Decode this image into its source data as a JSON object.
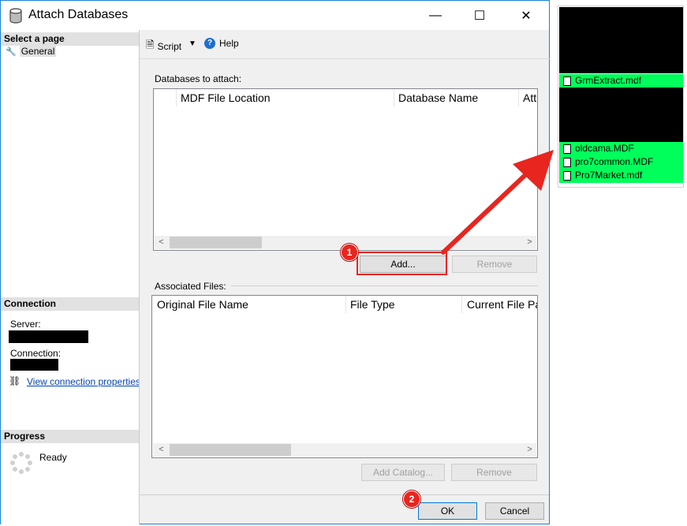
{
  "window": {
    "title": "Attach Databases",
    "minimize": "—",
    "maximize": "☐",
    "close": "✕"
  },
  "left_pane": {
    "select_page_header": "Select a page",
    "pages": [
      {
        "label": "General"
      }
    ],
    "connection_header": "Connection",
    "server_label": "Server:",
    "connection_label": "Connection:",
    "view_props_link": "View connection properties",
    "progress_header": "Progress",
    "progress_status": "Ready"
  },
  "toolbar": {
    "script_label": "Script",
    "help_label": "Help"
  },
  "databases": {
    "section_label": "Databases to attach:",
    "columns": [
      "MDF File Location",
      "Database Name",
      "Att"
    ],
    "add_button": "Add...",
    "remove_button": "Remove"
  },
  "associated": {
    "section_label": "Associated Files:",
    "columns": [
      "Original File Name",
      "File Type",
      "Current File Pa"
    ],
    "add_catalog_button": "Add Catalog...",
    "remove_button": "Remove"
  },
  "footer": {
    "ok_button": "OK",
    "cancel_button": "Cancel"
  },
  "callouts": {
    "step1": "1",
    "step2": "2"
  },
  "file_browser": {
    "files_top": [
      "GrmExtract.mdf"
    ],
    "files_bottom": [
      "oldcama.MDF",
      "pro7common.MDF",
      "Pro7Market.mdf"
    ],
    "highlight_color": "#00ff5a"
  },
  "colors": {
    "accent": "#0078d7",
    "callout_red": "#e8251f"
  }
}
